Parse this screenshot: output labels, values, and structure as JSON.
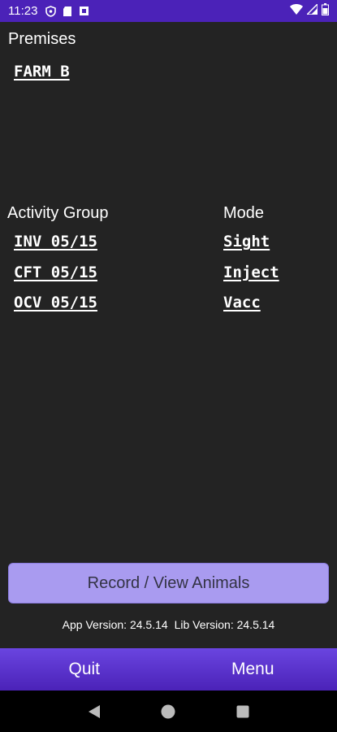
{
  "status_bar": {
    "time": "11:23",
    "icons": [
      "shield-icon",
      "sd-card-icon",
      "notification-icon",
      "wifi-icon",
      "signal-icon",
      "battery-icon"
    ]
  },
  "premises": {
    "label": "Premises",
    "value": "FARM B"
  },
  "activity": {
    "group_label": "Activity Group",
    "mode_label": "Mode",
    "rows": [
      {
        "group": "INV 05/15",
        "mode": "Sight"
      },
      {
        "group": "CFT 05/15",
        "mode": "Inject"
      },
      {
        "group": "OCV 05/15",
        "mode": "Vacc"
      }
    ]
  },
  "record_button": "Record / View Animals",
  "version": {
    "app": "App Version: 24.5.14",
    "lib": "Lib Version: 24.5.14"
  },
  "bottom_bar": {
    "quit": "Quit",
    "menu": "Menu"
  },
  "colors": {
    "accent": "#4b22b8",
    "button": "#a99bf0",
    "background": "#232323"
  }
}
